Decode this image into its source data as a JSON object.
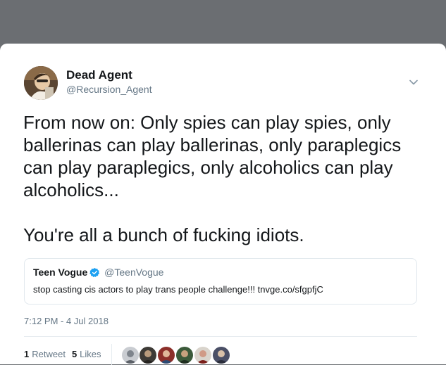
{
  "tweet": {
    "author": {
      "display_name": "Dead Agent",
      "handle": "@Recursion_Agent",
      "avatar_icon": "profile-photo"
    },
    "text": "From now on: Only spies can play spies, only\nballerinas can play ballerinas, only paraplegics\ncan play paraplegics, only alcoholics can play\nalcoholics...\n\nYou're all a bunch of fucking idiots.",
    "quoted": {
      "display_name": "Teen Vogue",
      "handle": "@TeenVogue",
      "verified": true,
      "text": "stop casting cis actors to play trans people challenge!!! tnvge.co/sfgpfjC"
    },
    "timestamp": "7:12 PM - 4 Jul 2018",
    "stats": {
      "retweet_count": "1",
      "retweet_label": "Retweet",
      "like_count": "5",
      "like_label": "Likes"
    },
    "liker_avatars": [
      "liker-avatar-1",
      "liker-avatar-2",
      "liker-avatar-3",
      "liker-avatar-4",
      "liker-avatar-5",
      "liker-avatar-6"
    ]
  },
  "colors": {
    "backdrop": "#6b6e72",
    "text_primary": "#14171a",
    "text_secondary": "#657786",
    "verified_blue": "#1da1f2",
    "border": "#e1e8ed"
  }
}
